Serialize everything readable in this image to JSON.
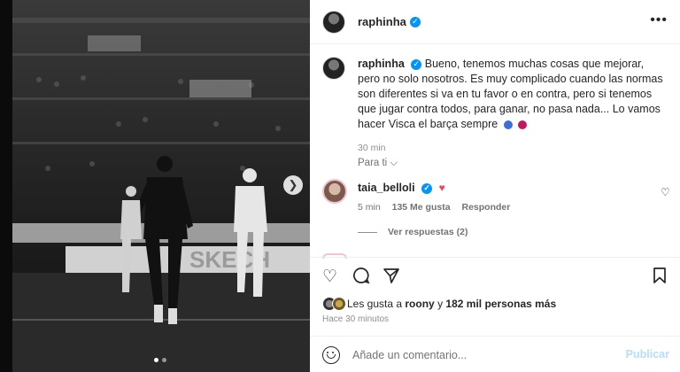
{
  "post": {
    "username": "raphinha",
    "verified_icon": "verified-badge-icon",
    "more_icon": "more-horizontal-icon"
  },
  "caption": {
    "username": "raphinha",
    "text": "Bueno, tenemos muchas cosas que mejorar, pero no solo nosotros. Es muy complicado cuando las normas son diferentes si va en tu favor o en contra, pero si tenemos que jugar contra todos, para ganar, no pasa nada... Lo vamos hacer Visca el barça sempre",
    "time": "30 min"
  },
  "filter": {
    "label": "Para ti",
    "icon": "chevron-down-icon"
  },
  "comments": [
    {
      "username": "taia_belloli",
      "time": "5 min",
      "likes": "135 Me gusta",
      "reply": "Responder",
      "view_replies": "Ver respuestas (2)"
    }
  ],
  "actions": {
    "icons": [
      "heart-icon",
      "comment-icon",
      "share-icon",
      "save-icon"
    ],
    "likes_prefix": "Les gusta a",
    "likes_user": "roony",
    "likes_connector": "y",
    "likes_others": "182 mil personas más",
    "posted": "Hace 30 minutos"
  },
  "composer": {
    "placeholder": "Añade un comentario...",
    "publish": "Publicar"
  },
  "colors": {
    "accent": "#0095f6",
    "publish_disabled": "#b2dffc",
    "heart": "#ed4956"
  }
}
